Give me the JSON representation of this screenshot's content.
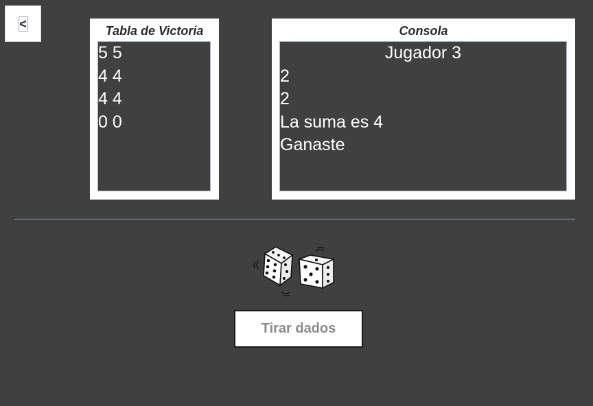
{
  "nav": {
    "back_label": "<"
  },
  "victory_table": {
    "title": "Tabla de Victoria",
    "rows": [
      "5 5",
      "4 4",
      "4 4",
      "0 0"
    ]
  },
  "console": {
    "title": "Consola",
    "player_line": "Jugador 3",
    "lines": [
      "2",
      "2",
      "La suma es 4",
      "Ganaste"
    ]
  },
  "dice": {
    "icon": "dice-icon",
    "left_die_face": 6,
    "right_die_face": 5
  },
  "actions": {
    "roll_label": "Tirar dados"
  },
  "colors": {
    "background": "#404040",
    "panel": "#ffffff",
    "text": "#ffffff",
    "button_text": "#8a8a8a",
    "divider": "#8fa6c8"
  }
}
